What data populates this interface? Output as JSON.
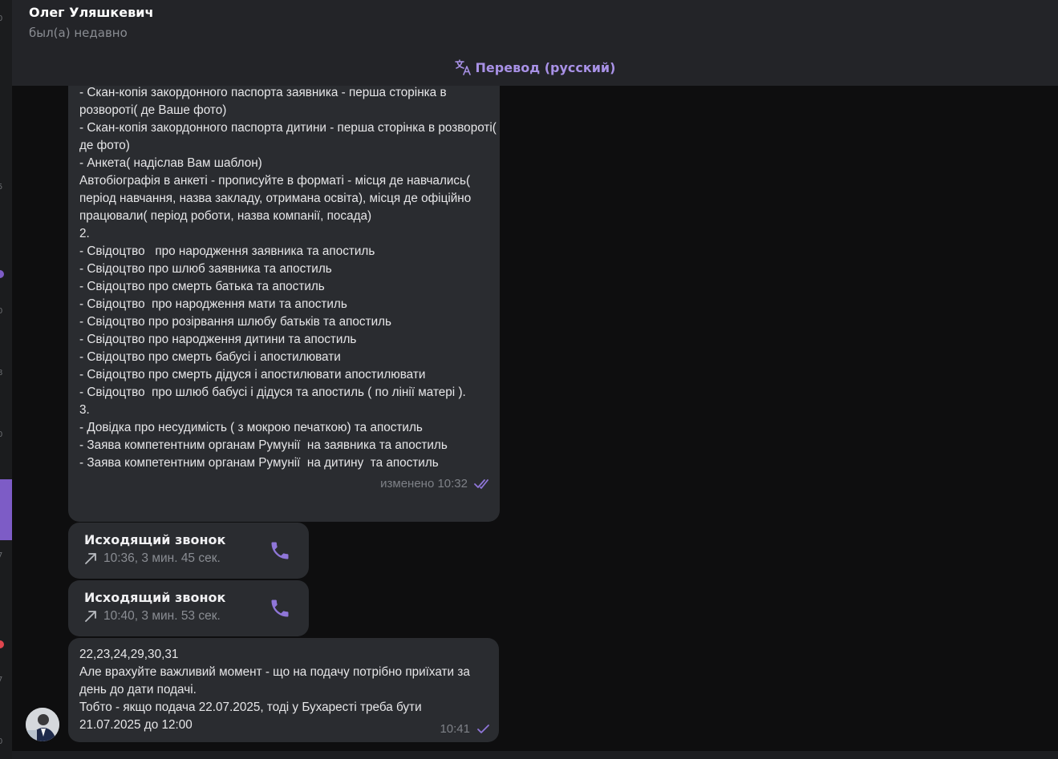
{
  "header": {
    "contact_name": "Олег Уляшкевич",
    "status": "был(а) недавно",
    "translate_label": "Перевод (русский)"
  },
  "sidebar_fragments": [
    "0",
    "5",
    "0",
    "8",
    "0",
    "7",
    "7",
    "0"
  ],
  "messages": {
    "long_text": "- Скан-копія закордонного паспорта заявника - перша сторінка в розвороті( де Ваше фото)\n- Скан-копія закордонного паспорта дитини - перша сторінка в розвороті( де фото)\n- Анкета( надіслав Вам шаблон)\nАвтобіографія в анкеті - прописуйте в форматі - місця де навчались( період навчання, назва закладу, отримана освіта), місця де офіційно працювали( період роботи, назва компанії, посада)\n2.\n- Свідоцтво   про народження заявника та апостиль\n- Свідоцтво про шлюб заявника та апостиль\n- Свідоцтво про смерть батька та апостиль\n- Свідоцтво  про народження мати та апостиль\n- Свідоцтво про розірвання шлюбу батьків та апостиль\n- Свідоцтво про народження дитини та апостиль\n- Свідоцтво про смерть бабусі і апостилювати\n- Свідоцтво про смерть дідуся і апостилювати апостилювати\n- Свідоцтво  про шлюб бабусі і дідуся та апостиль ( по лінії матері ).\n3.\n- Довідка про несудимість ( з мокрою печаткою) та апостиль\n- Заява компетентним органам Румунії  на заявника та апостиль\n- Заява компетентним органам Румунії  на дитину  та апостиль",
    "long_meta": "изменено 10:32",
    "call1_title": "Исходящий звонок",
    "call1_info": "10:36, 3 мин. 45 сек.",
    "call2_title": "Исходящий звонок",
    "call2_info": "10:40, 3 мин. 53 сек.",
    "last_text": "22,23,24,29,30,31\nАле врахуйте важливий момент - що на подачу потрібно приїхати за день до дати подачі.\nТобто - якщо подача 22.07.2025, тоді у Бухаресті треба бути 21.07.2025 до 12:00",
    "last_time": "10:41"
  },
  "colors": {
    "accent": "#a891e6",
    "bubble": "#2a2c30",
    "header": "#232428",
    "background": "#0e0e0f"
  },
  "icons": [
    "translate-icon",
    "double-check-icon",
    "outgoing-arrow-icon",
    "phone-icon",
    "single-check-icon"
  ]
}
